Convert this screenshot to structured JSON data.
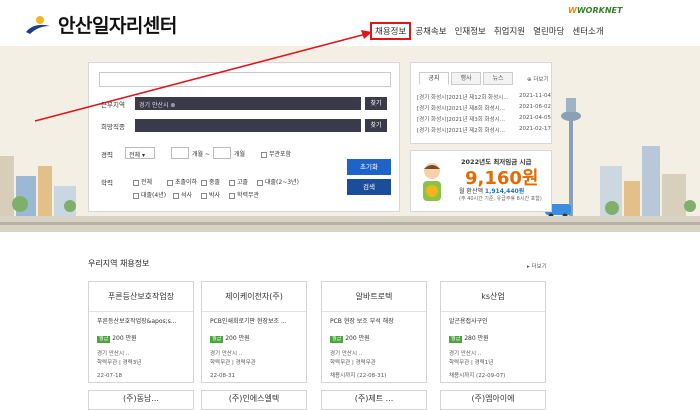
{
  "header": {
    "logo_text": "안산일자리센터",
    "worknet_brand": "WORKNET",
    "nav": [
      {
        "label": "채용정보",
        "active": true
      },
      {
        "label": "공채속보",
        "active": false
      },
      {
        "label": "인재정보",
        "active": false
      },
      {
        "label": "취업지원",
        "active": false
      },
      {
        "label": "열린마당",
        "active": false
      },
      {
        "label": "센터소개",
        "active": false
      }
    ]
  },
  "search": {
    "work_region_label": "근무지역",
    "work_region_value": "경기 안산시 ⊗",
    "job_type_label": "희망직종",
    "find_label": "찾기",
    "career_label": "경력",
    "career_select": "전체 ▾",
    "months_label": "개월 ~",
    "months_label2": "개월",
    "no_career_label": "무관포함",
    "education_label": "학력",
    "education_options": [
      "전체",
      "초졸이하",
      "중졸",
      "고졸",
      "대졸(2~3년)",
      "대졸(4년)",
      "석사",
      "박사",
      "학력무관"
    ],
    "reset_label": "초기화",
    "search_label": "검색"
  },
  "notice": {
    "tabs": [
      "공지",
      "행사",
      "뉴스"
    ],
    "more_label": "더보기",
    "items": [
      {
        "title": "[경기 화성시]2021년 제12회 화성시...",
        "date": "2021-11-04"
      },
      {
        "title": "[경기 화성시]2021년 제8회 화성시...",
        "date": "2021-06-02"
      },
      {
        "title": "[경기 화성시]2021년 제3회 화성시...",
        "date": "2021-04-05"
      },
      {
        "title": "[경기 화성시]2021년 제2회 화성시...",
        "date": "2021-02-17"
      }
    ]
  },
  "wage_banner": {
    "title": "2022년도 최저임금 시급",
    "amount": "9,160원",
    "monthly_prefix": "월 환산액",
    "monthly_value": "1,914,440원",
    "note": "(주 40시간 기준, 유급주휴 8시간 포함)"
  },
  "region_listings": {
    "title": "우리지역 채용정보",
    "more_label": "더보기",
    "cards": [
      {
        "company": "푸른등산보호작업장",
        "job": "푸른등산보호작업장&apos;s...",
        "badge": "월급",
        "pay": "200 만원",
        "location": "경기 안산시 ..",
        "condition": "학력무관 | 경력3년",
        "deadline": "22-07-18"
      },
      {
        "company": "제이케이전자(주)",
        "job": "PCB인쇄회로기판 현장보조 ...",
        "badge": "월급",
        "pay": "200 만원",
        "location": "경기 안산시 ..",
        "condition": "학력무관 | 경력무관",
        "deadline": "22-08-31"
      },
      {
        "company": "알바트로텍",
        "job": "PCB 현장 보조 부석 해장",
        "badge": "월급",
        "pay": "200 만원",
        "location": "경기 안산시 ..",
        "condition": "학력무관 | 경력무관",
        "deadline": "채용시까지 (22-08-31)"
      },
      {
        "company": "ks산업",
        "job": "알곤용접사구인",
        "badge": "월급",
        "pay": "280 만원",
        "location": "경기 안산시 ..",
        "condition": "학력무관 | 경력1년",
        "deadline": "채용시까지 (22-09-07)"
      }
    ],
    "row2": [
      "(주)동남...",
      "(주)인에스엘텍",
      "(주)제트 ...",
      "(주)엠아이에"
    ]
  }
}
